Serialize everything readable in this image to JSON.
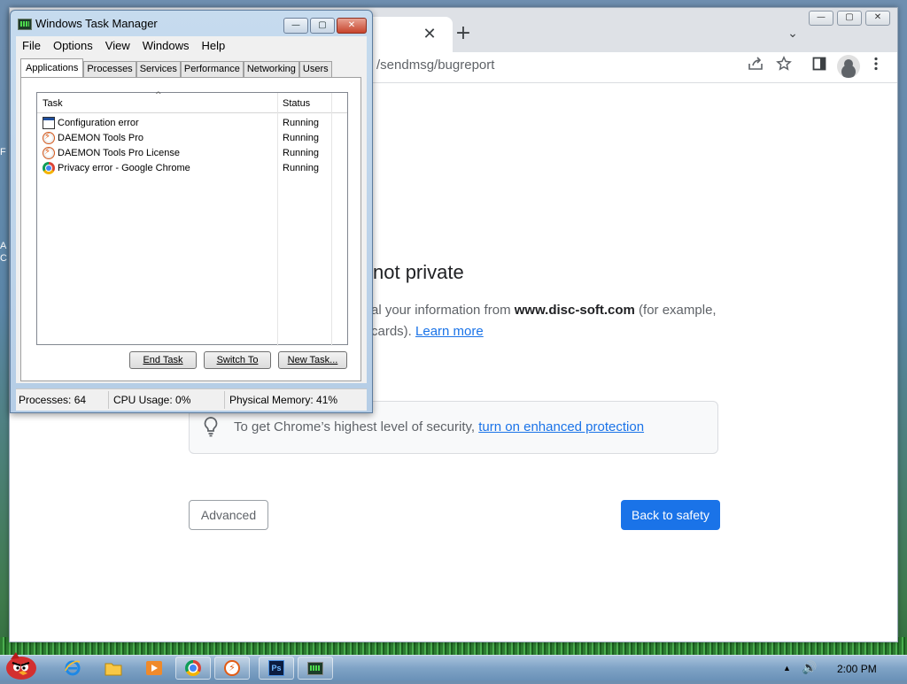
{
  "desktop": {
    "fragments": [
      "F",
      "A",
      "C"
    ]
  },
  "chrome": {
    "tab": {
      "close_glyph": "✕"
    },
    "new_tab_glyph": "+",
    "tab_dropdown_glyph": "⌄",
    "window_controls": {
      "minimize": "—",
      "maximize": "▢",
      "close": "✕"
    },
    "url": "/sendmsg/bugreport",
    "toolbar_icons": [
      "share-icon",
      "star-icon",
      "sidepanel-icon",
      "profile-icon",
      "kebab-menu-icon"
    ],
    "page": {
      "heading": "not private",
      "paragraph_before": "al your information from ",
      "domain": "www.disc-soft.com",
      "paragraph_after": " (for example,",
      "line2_prefix": "cards). ",
      "learn_more": "Learn more",
      "security_text": "To get Chrome’s highest level of security, ",
      "security_link": "turn on enhanced protection",
      "advanced_label": "Advanced",
      "back_label": "Back to safety"
    },
    "colors": {
      "accent": "#1a73e8"
    }
  },
  "task_manager": {
    "title": "Windows Task Manager",
    "menu": [
      "File",
      "Options",
      "View",
      "Windows",
      "Help"
    ],
    "tabs": [
      "Applications",
      "Processes",
      "Services",
      "Performance",
      "Networking",
      "Users"
    ],
    "active_tab": "Applications",
    "columns": {
      "task": "Task",
      "status": "Status",
      "sort_glyph": "^"
    },
    "rows": [
      {
        "task": "Configuration error",
        "status": "Running",
        "icon": "window-icon"
      },
      {
        "task": "DAEMON Tools Pro",
        "status": "Running",
        "icon": "daemon-tools-icon"
      },
      {
        "task": "DAEMON Tools Pro License",
        "status": "Running",
        "icon": "daemon-tools-icon"
      },
      {
        "task": "Privacy error - Google Chrome",
        "status": "Running",
        "icon": "chrome-icon"
      }
    ],
    "buttons": {
      "end_task": "End Task",
      "switch_to": "Switch To",
      "new_task": "New Task..."
    },
    "status": {
      "processes": "Processes: 64",
      "cpu": "CPU Usage: 0%",
      "memory": "Physical Memory: 41%"
    },
    "window_controls": {
      "minimize": "—",
      "maximize": "▢",
      "close": "✕"
    }
  },
  "taskbar": {
    "items": [
      "start-button",
      "ie-icon",
      "explorer-icon",
      "media-player-icon",
      "chrome-icon",
      "daemon-tools-icon",
      "photoshop-icon",
      "task-manager-icon"
    ],
    "photoshop_label": "Ps",
    "tray_arrow": "▲",
    "volume_glyph": "🔊",
    "clock": "2:00 PM"
  }
}
